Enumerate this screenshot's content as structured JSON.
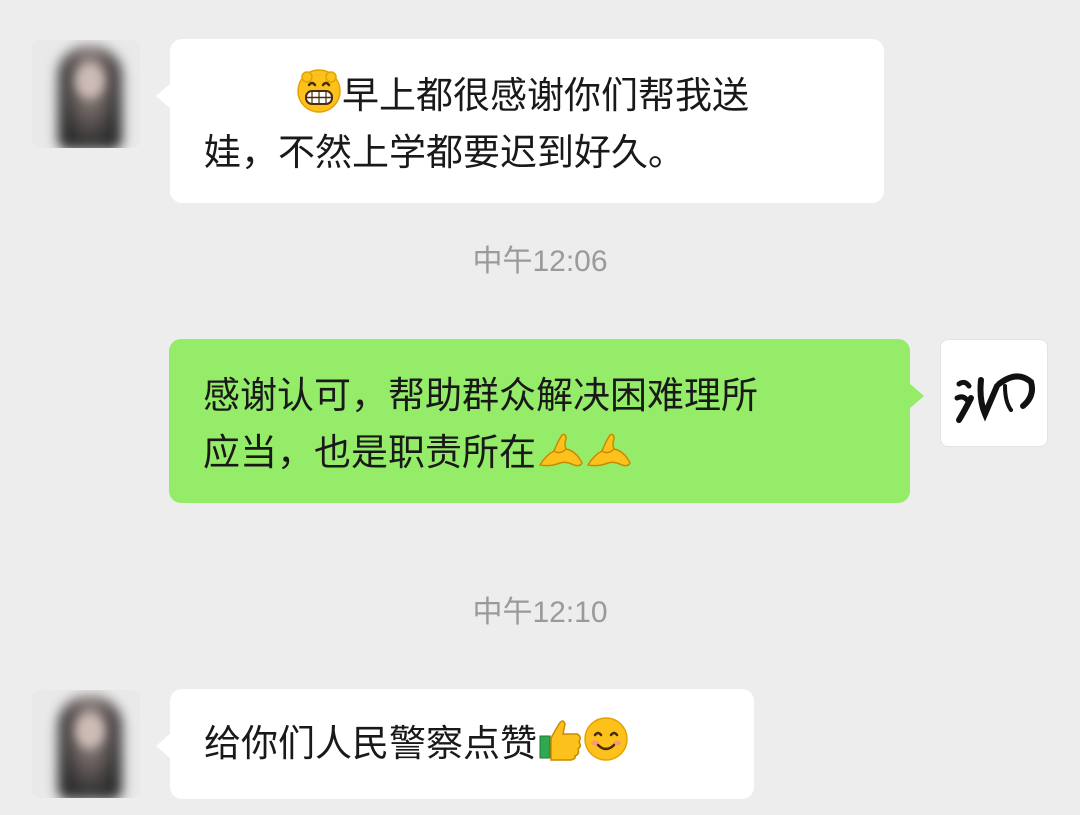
{
  "messages": [
    {
      "sender": "other",
      "line1": "早上都很感谢你们帮我送",
      "line2": "娃，不然上学都要迟到好久。",
      "emojis": [
        "grinning-face-icon"
      ]
    },
    {
      "timestamp": "中午12:06"
    },
    {
      "sender": "self",
      "line1": "感谢认可，帮助群众解决困难理所",
      "line2": "应当，也是职责所在",
      "emojis": [
        "ok-hand-icon",
        "ok-hand-icon"
      ]
    },
    {
      "timestamp": "中午12:10"
    },
    {
      "sender": "other",
      "line1": "给你们人民警察点赞",
      "emojis": [
        "thumbs-up-icon",
        "smiling-face-icon"
      ]
    }
  ],
  "colors": {
    "background": "#ededed",
    "incoming_bubble": "#ffffff",
    "outgoing_bubble": "#95ec69",
    "timestamp_text": "#9a9a9a",
    "message_text": "#191919"
  }
}
